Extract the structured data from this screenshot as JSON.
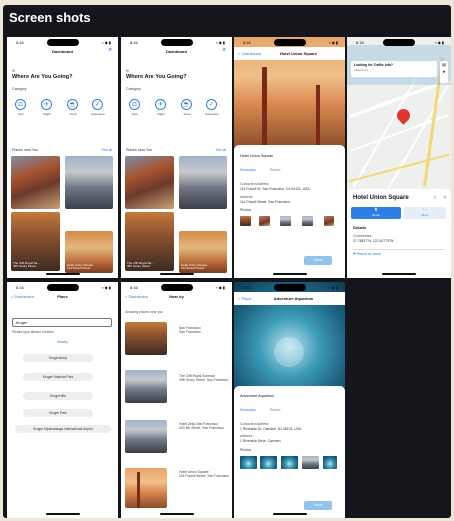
{
  "title": "Screen shots",
  "colors": {
    "accent": "#2f7ee5",
    "button": "#8ec4ee",
    "panel_bg": "#14161b",
    "outer_bg": "#ede6d9"
  },
  "status": {
    "time": "8:16",
    "icons": "▪︎◆▮"
  },
  "screens": {
    "dashboard1": {
      "nav_title": "Dashboard",
      "greeting_hi": "Hi",
      "heading": "Where Are You Going?",
      "category_label": "Category",
      "categories": [
        "Gym",
        "Flight",
        "Food",
        "Adventure"
      ],
      "places_label": "Places near You",
      "see_all": "See all",
      "tiles": [
        {
          "name": "",
          "address": ""
        },
        {
          "name": "",
          "address": ""
        },
        {
          "name": "The Clift Royal Sa...",
          "address": "495 Geary Street"
        },
        {
          "name": "Hotel Union Square",
          "address": "114 Powell Street"
        }
      ]
    },
    "dashboard2": {
      "nav_title": "Dashboard",
      "greeting_hi": "Hi",
      "heading": "Where Are You Going?",
      "category_label": "Category",
      "categories": [
        "Gym",
        "Flight",
        "Food",
        "Adventure"
      ],
      "places_label": "Places near You",
      "see_all": "See all",
      "tiles": [
        {
          "name": "",
          "address": ""
        },
        {
          "name": "",
          "address": ""
        },
        {
          "name": "The Clift Royal Sa...",
          "address": "495 Geary Street"
        },
        {
          "name": "Hotel Union Square",
          "address": "114 Powell Street"
        }
      ]
    },
    "hotel_detail": {
      "back": "< Dashboard",
      "nav_title": "Hotel Union Square",
      "name": "Hotel Union Square",
      "tabs": [
        "Description",
        "Review"
      ],
      "contact_label": "Contacted Address",
      "address1": "114 Powell St, San Francisco, CA 94102, USA",
      "address_label": "Address",
      "address2": "114 Powell Street, San Francisco",
      "photos_label": "Photos",
      "button": "Travel"
    },
    "map": {
      "traffic_question": "Looking for Traffic info?",
      "traffic_sub": "Search for",
      "hotel": "Hotel Union Square",
      "route_btn": "Route",
      "more_btn": "More",
      "details_label": "Details",
      "coords_label": "Coordinates",
      "coords": "37.78837°N, 122.40773°W",
      "report": "Report an issue"
    },
    "place_search": {
      "back": "< Dashboard",
      "nav_title": "Place",
      "input_value": "Kruger",
      "hint": "Please type atleast 3 letters",
      "nearby": "Nearby",
      "results": [
        "Krugersdorp",
        "Kruger National Park",
        "Krugerville",
        "Kruger Park",
        "Kruger Mpumalanga International Airport"
      ]
    },
    "nearby": {
      "back": "< Dashboard",
      "nav_title": "Near by",
      "intro": "Amazing places near you",
      "items": [
        {
          "name": "San Francisco",
          "address": "San Francisco"
        },
        {
          "name": "The Clift Royal Sonesta",
          "address": "495 Geary Street, San Francisco"
        },
        {
          "name": "Hotel Zeko San Francisco",
          "address": "420 4th Street, San Francisco"
        },
        {
          "name": "Hotel Union Square",
          "address": "114 Powell Street, San Francisco"
        }
      ]
    },
    "aquarium": {
      "back": "< Place",
      "nav_title": "Adventure Aquarium",
      "name": "Adventure Aquarium",
      "tabs": [
        "Description",
        "Review"
      ],
      "contact_label": "Contacted Address",
      "address1": "1 Riverside Dr, Camden, NJ 08103, USA",
      "address_label": "Address",
      "address2": "1 Riverside Drive, Camden",
      "photos_label": "Photos",
      "button": "Travel"
    }
  }
}
